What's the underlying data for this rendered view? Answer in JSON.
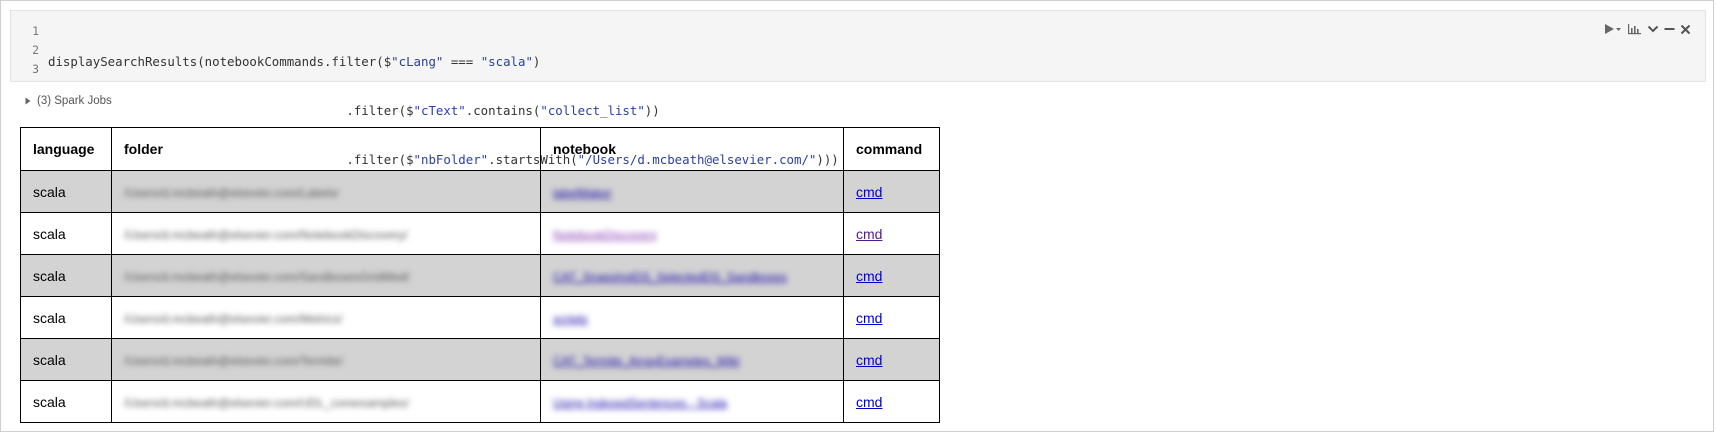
{
  "code": {
    "line_numbers": [
      "1",
      "2",
      "3"
    ],
    "lines": [
      {
        "a": "displaySearchResults(notebookCommands.filter($",
        "s1": "\"cLang\"",
        "b": " === ",
        "s2": "\"scala\"",
        "c": ")"
      },
      {
        "a": "                                        .filter($",
        "s1": "\"cText\"",
        "b": ".contains(",
        "s2": "\"collect_list\"",
        "c": "))"
      },
      {
        "a": "                                        .filter($",
        "s1": "\"nbFolder\"",
        "b": ".startsWith(",
        "s2": "\"/Users/d.mcbeath@elsevier.com/\"",
        "c": ")))"
      }
    ]
  },
  "toolbar": {
    "icons": [
      "run-menu-icon",
      "chart-icon",
      "chevron-down-icon",
      "minimize-icon",
      "close-icon"
    ]
  },
  "spark_jobs": {
    "label": "(3) Spark Jobs"
  },
  "table": {
    "headers": [
      "language",
      "folder",
      "notebook",
      "command"
    ],
    "rows": [
      {
        "language": "scala",
        "folder": "/Users/d.mcbeath@elsevier.com/Labels/",
        "notebook": "labelMaker",
        "command": "cmd"
      },
      {
        "language": "scala",
        "folder": "/Users/d.mcbeath@elsevier.com/NotebookDiscovery/",
        "notebook": "NotebookDiscovery",
        "command": "cmd"
      },
      {
        "language": "scala",
        "folder": "/Users/d.mcbeath@elsevier.com/SandboxesGridMed/",
        "notebook": "CAT_SnapshotDS_SelectedDS_Sandboxes",
        "command": "cmd"
      },
      {
        "language": "scala",
        "folder": "/Users/d.mcbeath@elsevier.com/Metrics/",
        "notebook": "scripts",
        "command": "cmd"
      },
      {
        "language": "scala",
        "folder": "/Users/d.mcbeath@elsevier.com/Termite/",
        "notebook": "CAT_Termite_ArrayExamples_Wiki",
        "command": "cmd"
      },
      {
        "language": "scala",
        "folder": "/Users/d.mcbeath@elsevier.com/UDL_coreexamples/",
        "notebook": "Using IndexedSentences - Scala",
        "command": "cmd"
      }
    ]
  }
}
